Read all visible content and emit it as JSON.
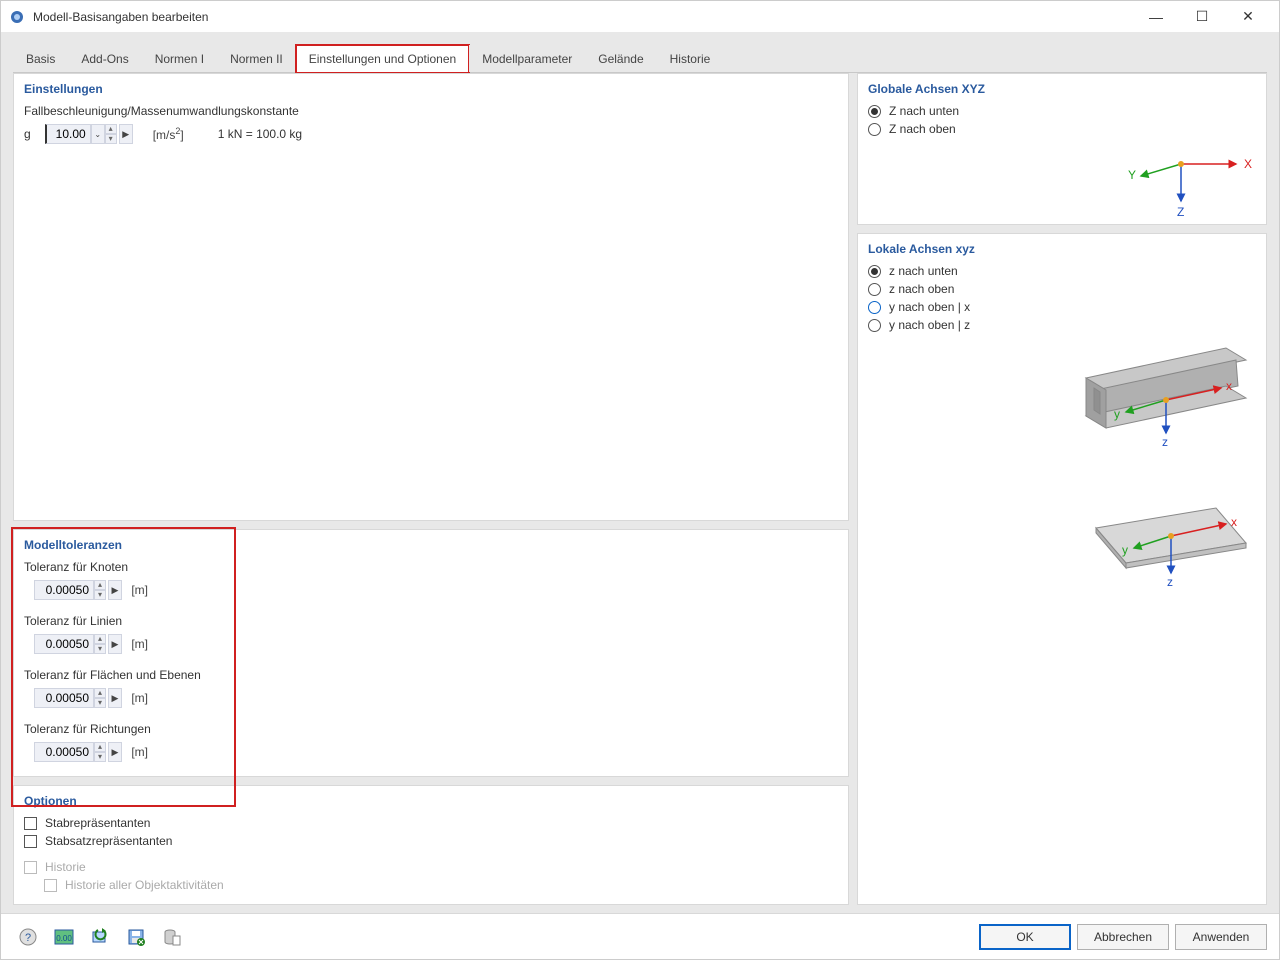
{
  "window": {
    "title": "Modell-Basisangaben bearbeiten"
  },
  "tabs": [
    "Basis",
    "Add-Ons",
    "Normen I",
    "Normen II",
    "Einstellungen und Optionen",
    "Modellparameter",
    "Gelände",
    "Historie"
  ],
  "active_tab_index": 4,
  "settings": {
    "title": "Einstellungen",
    "desc": "Fallbeschleunigung/Massenumwandlungskonstante",
    "g_label": "g",
    "g_value": "10.00",
    "g_unit": "[m/s²]",
    "g_note": "1 kN = 100.0 kg"
  },
  "tolerances": {
    "title": "Modelltoleranzen",
    "items": [
      {
        "label": "Toleranz für Knoten",
        "value": "0.00050",
        "unit": "[m]"
      },
      {
        "label": "Toleranz für Linien",
        "value": "0.00050",
        "unit": "[m]"
      },
      {
        "label": "Toleranz für Flächen und Ebenen",
        "value": "0.00050",
        "unit": "[m]"
      },
      {
        "label": "Toleranz für Richtungen",
        "value": "0.00050",
        "unit": "[m]"
      }
    ]
  },
  "options": {
    "title": "Optionen",
    "items": [
      {
        "label": "Stabrepräsentanten",
        "checked": false,
        "disabled": false
      },
      {
        "label": "Stabsatzrepräsentanten",
        "checked": false,
        "disabled": false
      },
      {
        "label": "Historie",
        "checked": false,
        "disabled": true
      },
      {
        "label": "Historie aller Objektaktivitäten",
        "checked": false,
        "disabled": true,
        "indent": true
      }
    ]
  },
  "global_axes": {
    "title": "Globale Achsen XYZ",
    "options": [
      {
        "label": "Z nach unten",
        "checked": true
      },
      {
        "label": "Z nach oben",
        "checked": false
      }
    ],
    "labels": {
      "x": "X",
      "y": "Y",
      "z": "Z"
    }
  },
  "local_axes": {
    "title": "Lokale Achsen xyz",
    "options": [
      {
        "label": "z nach unten",
        "checked": true
      },
      {
        "label": "z nach oben",
        "checked": false
      },
      {
        "label": "y nach oben | x",
        "checked": false,
        "blue": true
      },
      {
        "label": "y nach oben | z",
        "checked": false
      }
    ],
    "labels": {
      "x": "x",
      "y": "y",
      "z": "z"
    }
  },
  "buttons": {
    "ok": "OK",
    "cancel": "Abbrechen",
    "apply": "Anwenden"
  }
}
